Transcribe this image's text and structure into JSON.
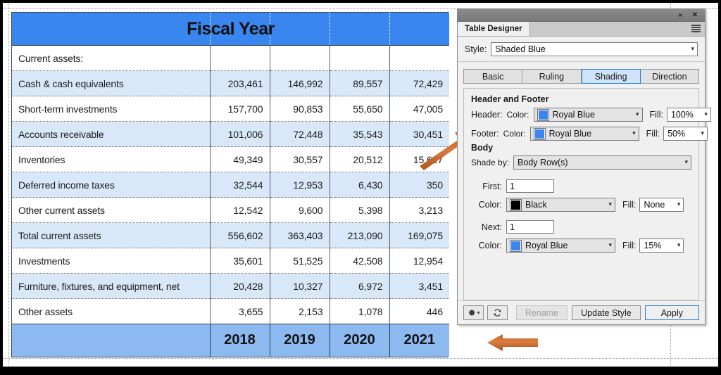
{
  "document": {
    "table": {
      "header_title": "Fiscal Year",
      "row_label_header": "",
      "rows": [
        {
          "label": "Current assets:",
          "values": [
            "",
            "",
            "",
            ""
          ]
        },
        {
          "label": "Cash & cash equivalents",
          "values": [
            "203,461",
            "146,992",
            "89,557",
            "72,429"
          ]
        },
        {
          "label": "Short-term investments",
          "values": [
            "157,700",
            "90,853",
            "55,650",
            "47,005"
          ]
        },
        {
          "label": "Accounts receivable",
          "values": [
            "101,006",
            "72,448",
            "35,543",
            "30,451"
          ]
        },
        {
          "label": "Inventories",
          "values": [
            "49,349",
            "30,557",
            "20,512",
            "15,627"
          ]
        },
        {
          "label": "Deferred income taxes",
          "values": [
            "32,544",
            "12,953",
            "6,430",
            "350"
          ]
        },
        {
          "label": "Other current assets",
          "values": [
            "12,542",
            "9,600",
            "5,398",
            "3,213"
          ]
        },
        {
          "label": "Total current assets",
          "values": [
            "556,602",
            "363,403",
            "213,090",
            "169,075"
          ]
        },
        {
          "label": "Investments",
          "values": [
            "35,601",
            "51,525",
            "42,508",
            "12,954"
          ]
        },
        {
          "label": "Furniture, fixtures, and equipment, net",
          "values": [
            "20,428",
            "10,327",
            "6,972",
            "3,451"
          ]
        },
        {
          "label": "Other assets",
          "values": [
            "3,655",
            "2,153",
            "1,078",
            "446"
          ]
        }
      ],
      "footer": {
        "label": "",
        "values": [
          "2018",
          "2019",
          "2020",
          "2021"
        ]
      },
      "colors": {
        "header_fill": "#3a86f0",
        "footer_fill": "#8cbaf0",
        "body_shade": "#d9e8f9",
        "body_plain": "#ffffff"
      }
    },
    "annotations": [
      {
        "name": "arrow-to-footer-label",
        "color": "#d2702f"
      },
      {
        "name": "arrow-to-table-footer-row",
        "color": "#d2702f"
      }
    ]
  },
  "panel": {
    "title": "Table Designer",
    "titlebar": {
      "collapse_icon": "collapse-icon",
      "close_icon": "close-icon"
    },
    "menu_icon": "hamburger-menu-icon",
    "style": {
      "label": "Style:",
      "value": "Shaded Blue"
    },
    "tabs": [
      {
        "label": "Basic",
        "active": false
      },
      {
        "label": "Ruling",
        "active": false
      },
      {
        "label": "Shading",
        "active": true
      },
      {
        "label": "Direction",
        "active": false
      }
    ],
    "shading": {
      "header_footer_title": "Header and Footer",
      "header": {
        "label": "Header:",
        "color_label": "Color:",
        "color_value": "Royal Blue",
        "swatch": "#3a86f0",
        "fill_label": "Fill:",
        "fill_value": "100%"
      },
      "footer": {
        "label": "Footer:",
        "color_label": "Color:",
        "color_value": "Royal Blue",
        "swatch": "#3a86f0",
        "fill_label": "Fill:",
        "fill_value": "50%"
      },
      "body_title": "Body",
      "shade_by": {
        "label": "Shade by:",
        "value": "Body Row(s)"
      },
      "first": {
        "label": "First:",
        "value": "1",
        "color_label": "Color:",
        "color_value": "Black",
        "swatch": "#000000",
        "fill_label": "Fill:",
        "fill_value": "None"
      },
      "next": {
        "label": "Next:",
        "value": "1",
        "color_label": "Color:",
        "color_value": "Royal Blue",
        "swatch": "#3a86f0",
        "fill_label": "Fill:",
        "fill_value": "15%"
      }
    },
    "footer_bar": {
      "gear_icon": "gear-icon",
      "refresh_icon": "refresh-icon",
      "rename_label": "Rename",
      "update_style_label": "Update Style",
      "apply_label": "Apply"
    }
  }
}
